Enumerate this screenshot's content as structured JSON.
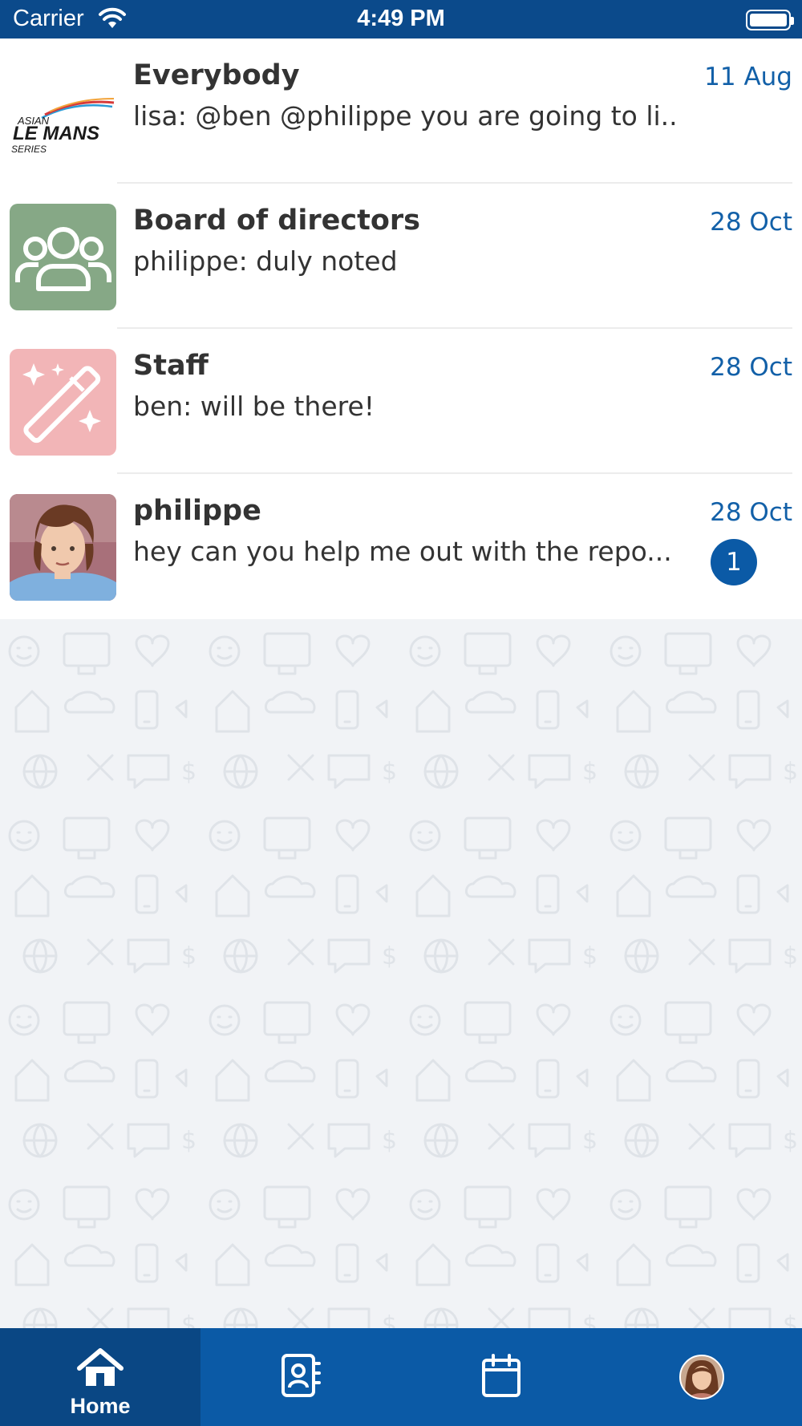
{
  "status_bar": {
    "carrier": "Carrier",
    "time": "4:49 PM",
    "background_color": "#0b4a8b"
  },
  "conversations": [
    {
      "name": "Everybody",
      "preview": "lisa: @ben @philippe you are going to li...",
      "date": "11 Aug",
      "avatar": "asian-le-mans-series-logo",
      "avatar_text": {
        "line1": "ASIAN",
        "line2": "LE MANS",
        "line3": "SERIES"
      }
    },
    {
      "name": "Board of directors",
      "preview": "philippe: duly noted",
      "date": "28 Oct",
      "avatar": "group-icon",
      "avatar_color": "#86a886"
    },
    {
      "name": "Staff",
      "preview": "ben: will be there!",
      "date": "28 Oct",
      "avatar": "magic-wand-icon",
      "avatar_color": "#f2b5b7"
    },
    {
      "name": "philippe",
      "preview": "hey can you help me out with the repo...",
      "date": "28 Oct",
      "avatar": "user-photo",
      "unread_count": "1"
    }
  ],
  "tab_bar": {
    "tabs": [
      {
        "name": "home",
        "label": "Home",
        "icon": "home-icon",
        "active": true
      },
      {
        "name": "contacts",
        "label": "",
        "icon": "address-book-icon",
        "active": false
      },
      {
        "name": "calendar",
        "label": "",
        "icon": "calendar-icon",
        "active": false
      },
      {
        "name": "profile",
        "label": "",
        "icon": "profile-avatar",
        "active": false
      }
    ],
    "background_color": "#0b5aa6",
    "active_color": "#0a4784"
  },
  "colors": {
    "accent": "#1260a8",
    "unread_badge": "#0b5aa6",
    "text": "#333333",
    "list_background": "#f1f3f6"
  }
}
